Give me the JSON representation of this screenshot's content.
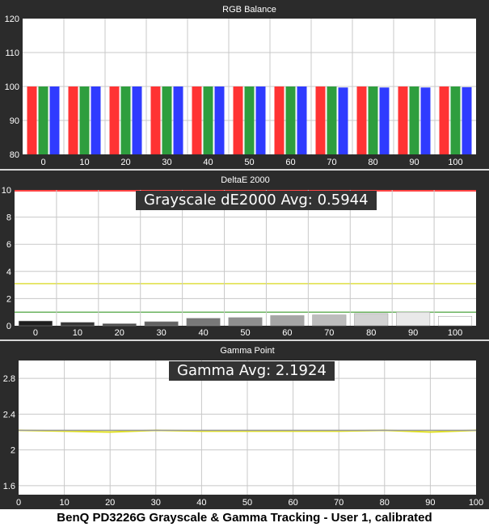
{
  "colors": {
    "background": "#2b2b2b",
    "plot": "#ffffff",
    "grid": "#c8c8c8",
    "red": "#ff3333",
    "green": "#2e9e3e",
    "blue": "#2f3bff",
    "limit_red": "#ff4444",
    "limit_yellow": "#d4d400",
    "limit_green": "#3a9a2a",
    "gamma_line": "#e0e020"
  },
  "caption": "BenQ PD3226G Grayscale & Gamma Tracking - User 1, calibrated",
  "overlays": {
    "grayscale": "Grayscale dE2000 Avg: 0.5944",
    "gamma": "Gamma Avg: 2.1924"
  },
  "chart_data": [
    {
      "type": "bar",
      "title": "RGB Balance",
      "categories": [
        "0",
        "10",
        "20",
        "30",
        "40",
        "50",
        "60",
        "70",
        "80",
        "90",
        "100"
      ],
      "ylim": [
        80,
        120
      ],
      "yticks": [
        80,
        90,
        100,
        110,
        120
      ],
      "grid": true,
      "series": [
        {
          "color": "red",
          "values": [
            100,
            100,
            100,
            100,
            100,
            100,
            100,
            100,
            100,
            100,
            100
          ]
        },
        {
          "color": "green",
          "values": [
            100,
            100,
            100,
            100,
            100,
            100,
            100,
            100,
            100,
            100,
            100
          ]
        },
        {
          "color": "blue",
          "values": [
            100,
            100,
            100,
            100,
            100,
            100,
            100,
            99.7,
            99.7,
            99.7,
            99.8
          ]
        }
      ]
    },
    {
      "type": "bar",
      "title": "DeltaE 2000",
      "categories": [
        "0",
        "10",
        "20",
        "30",
        "40",
        "50",
        "60",
        "70",
        "80",
        "90",
        "100"
      ],
      "ylim": [
        0,
        10
      ],
      "yticks": [
        0,
        2,
        4,
        6,
        8,
        10
      ],
      "grid": true,
      "values": [
        0.35,
        0.25,
        0.15,
        0.3,
        0.55,
        0.6,
        0.75,
        0.8,
        0.9,
        1.0,
        0.7
      ],
      "thresholds": [
        10,
        3.1,
        1.0
      ]
    },
    {
      "type": "line",
      "title": "Gamma Point",
      "x": [
        0,
        10,
        20,
        30,
        40,
        50,
        60,
        70,
        80,
        90,
        100
      ],
      "xticks": [
        0,
        10,
        20,
        30,
        40,
        50,
        60,
        70,
        80,
        90,
        100
      ],
      "series": [
        {
          "color": "gamma",
          "values": [
            2.22,
            2.21,
            2.2,
            2.22,
            2.21,
            2.21,
            2.21,
            2.21,
            2.22,
            2.2,
            2.22
          ]
        },
        {
          "color": "gray",
          "values": [
            2.22,
            2.22,
            2.22,
            2.22,
            2.22,
            2.22,
            2.22,
            2.22,
            2.22,
            2.22,
            2.22
          ]
        }
      ],
      "ylim": [
        1.5,
        3.0
      ],
      "yticks": [
        1.6,
        2.0,
        2.4,
        2.8
      ],
      "grid": true
    }
  ]
}
